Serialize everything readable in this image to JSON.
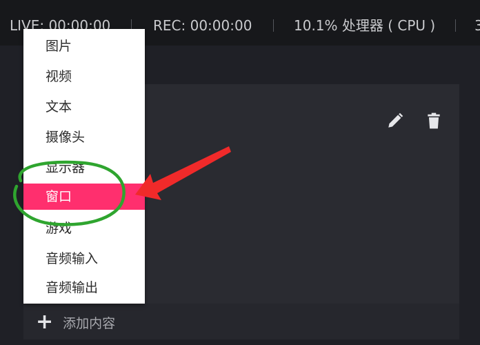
{
  "status_bar": {
    "live": "LIVE: 00:00:00",
    "rec": "REC: 00:00:00",
    "cpu": "10.1% 处理器 ( CPU )",
    "extra": "3"
  },
  "menu": {
    "items": [
      {
        "label": "图片"
      },
      {
        "label": "视频"
      },
      {
        "label": "文本"
      },
      {
        "label": "摄像头"
      },
      {
        "label": "显示器"
      },
      {
        "label": "窗口",
        "selected": true
      },
      {
        "label": "游戏"
      },
      {
        "label": "音频输入"
      },
      {
        "label": "音频输出"
      }
    ]
  },
  "panel": {
    "add_content_label": "添加内容",
    "icons": [
      "pencil-icon",
      "trash-icon",
      "plus-icon"
    ]
  },
  "colors": {
    "selected_item": "#ff2f6e",
    "annotation_arrow": "#f02a2a",
    "annotation_circle": "#2fa52f"
  }
}
